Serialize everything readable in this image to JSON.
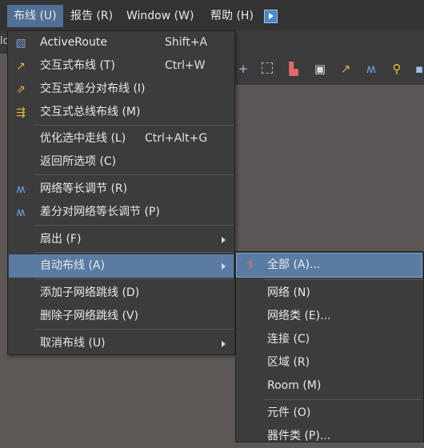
{
  "menubar": {
    "items": [
      {
        "label": "布线 (U)"
      },
      {
        "label": "报告 (R)"
      },
      {
        "label": "Window (W)"
      },
      {
        "label": "帮助 (H)"
      }
    ]
  },
  "toolbar": {
    "doc_tab_fragment": "lo"
  },
  "route_menu": {
    "items": [
      {
        "label": "ActiveRoute",
        "shortcut": "Shift+A",
        "icon": "active-route-icon"
      },
      {
        "label": "交互式布线 (T)",
        "shortcut": "Ctrl+W",
        "icon": "interactive-route-icon"
      },
      {
        "label": "交互式差分对布线 (I)",
        "icon": "diff-pair-route-icon"
      },
      {
        "label": "交互式总线布线 (M)",
        "icon": "bus-route-icon"
      },
      {
        "label": "优化选中走线 (L)",
        "shortcut": "Ctrl+Alt+G"
      },
      {
        "label": "返回所选项 (C)"
      },
      {
        "label": "网络等长调节 (R)",
        "icon": "length-tune-icon"
      },
      {
        "label": "差分对网络等长调节 (P)",
        "icon": "diff-length-tune-icon"
      },
      {
        "label": "扇出 (F)"
      },
      {
        "label": "自动布线 (A)"
      },
      {
        "label": "添加子网络跳线 (D)"
      },
      {
        "label": "删除子网络跳线 (V)"
      },
      {
        "label": "取消布线 (U)"
      }
    ]
  },
  "autoroute_submenu": {
    "items": [
      {
        "label": "全部 (A)...",
        "icon": "autoroute-all-icon"
      },
      {
        "label": "网络 (N)"
      },
      {
        "label": "网络类 (E)..."
      },
      {
        "label": "连接 (C)"
      },
      {
        "label": "区域 (R)"
      },
      {
        "label": "Room (M)"
      },
      {
        "label": "元件 (O)"
      },
      {
        "label": "器件类 (P)..."
      }
    ]
  },
  "colors": {
    "highlight": "#5a7ca3",
    "menubar_active": "#4f6f94",
    "menu_bg": "#3c3c3c"
  }
}
